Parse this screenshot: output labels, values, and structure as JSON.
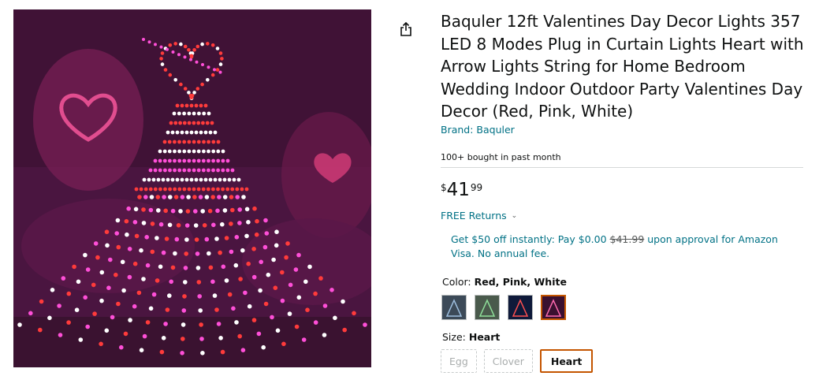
{
  "product": {
    "title": "Baquler 12ft Valentines Day Decor Lights 357 LED 8 Modes Plug in Curtain Lights Heart with Arrow Lights String for Home Bedroom Wedding Indoor Outdoor Party Valentines Day Decor (Red, Pink, White)",
    "brand": "Brand: Baquler",
    "bought": "100+ bought in past month",
    "image_alt": "Heart-topped LED curtain lights shaped like a dress"
  },
  "price": {
    "symbol": "$",
    "whole": "41",
    "fraction": "99"
  },
  "returns": {
    "label": "FREE Returns",
    "chevron_icon": "chevron-down-icon"
  },
  "promo": {
    "text_before": "Get $50 off instantly: Pay $0.00 ",
    "struck_price": "$41.99",
    "text_after": " upon approval for Amazon Visa. No annual fee."
  },
  "color": {
    "label": "Color: ",
    "selected": "Red, Pink, White",
    "swatch_names": [
      "Blue",
      "Green",
      "Multicolor",
      "Red, Pink, White"
    ],
    "swatch_tints": [
      "#6f8aa3",
      "#6b9e6f",
      "#d04040",
      "#e05a9a"
    ]
  },
  "size": {
    "label": "Size: ",
    "selected": "Heart",
    "options": [
      {
        "label": "Egg",
        "state": "unavailable"
      },
      {
        "label": "Clover",
        "state": "unavailable"
      },
      {
        "label": "Heart",
        "state": "selected"
      }
    ]
  },
  "colors": {
    "link": "#007185",
    "selected_border": "#c45500",
    "light_red": "#ff3b3b",
    "light_pink": "#ff4fd8",
    "light_white": "#ffffff"
  }
}
